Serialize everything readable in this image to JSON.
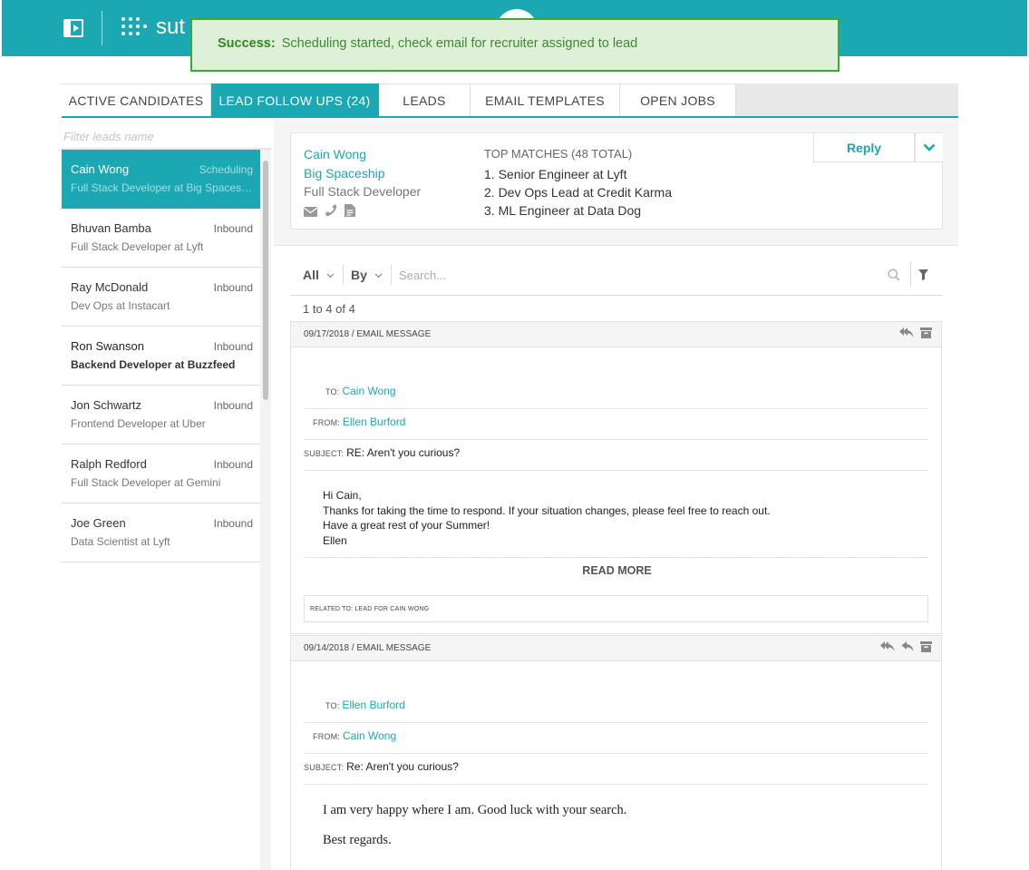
{
  "app": {
    "logo_text": "sut"
  },
  "toast": {
    "label": "Success:",
    "message": " Scheduling started, check email for recruiter assigned to lead"
  },
  "tabs": [
    {
      "label": "ACTIVE CANDIDATES"
    },
    {
      "label": "LEAD FOLLOW UPS (24)"
    },
    {
      "label": "LEADS"
    },
    {
      "label": "EMAIL TEMPLATES"
    },
    {
      "label": "OPEN JOBS"
    }
  ],
  "sidebar": {
    "filter_placeholder": "Filter leads name",
    "leads": [
      {
        "name": "Cain Wong",
        "status": "Scheduling",
        "desc": "Full Stack Developer at Big Spaceship"
      },
      {
        "name": "Bhuvan Bamba",
        "status": "Inbound",
        "desc": "Full Stack Developer at Lyft"
      },
      {
        "name": "Ray McDonald",
        "status": "Inbound",
        "desc": "Dev Ops at Instacart"
      },
      {
        "name": "Ron Swanson",
        "status": "Inbound",
        "desc": "Backend Developer at Buzzfeed"
      },
      {
        "name": "Jon Schwartz",
        "status": "Inbound",
        "desc": "Frontend Developer at Uber"
      },
      {
        "name": "Ralph Redford",
        "status": "Inbound",
        "desc": "Full Stack Developer at Gemini"
      },
      {
        "name": "Joe Green",
        "status": "Inbound",
        "desc": "Data Scientist at Lyft"
      }
    ]
  },
  "lead_card": {
    "name": "Cain Wong",
    "company": "Big Spaceship",
    "title": "Full Stack Developer",
    "matches_header": "TOP MATCHES (48 TOTAL)",
    "matches": [
      "1. Senior Engineer at Lyft",
      "2. Dev Ops Lead at Credit Karma",
      "3. ML Engineer at Data Dog"
    ],
    "reply_label": "Reply"
  },
  "filterbar": {
    "all_label": "All",
    "by_label": "By",
    "search_placeholder": "Search..."
  },
  "count_text": "1 to 4 of 4",
  "labels": {
    "to": "TO:",
    "from": "FROM:",
    "subject": "SUBJECT:"
  },
  "messages": [
    {
      "header": "09/17/2018 / EMAIL MESSAGE",
      "to": "Cain Wong",
      "from": "Ellen Burford",
      "subject": "RE: Aren't you curious?",
      "body": [
        "Hi Cain,",
        "Thanks for taking the time to respond. If your situation changes, please feel free to reach out.",
        "Have a great rest of your Summer!",
        "Ellen"
      ],
      "read_more": "READ MORE",
      "related": "RELATED TO: LEAD FOR CAIN WONG"
    },
    {
      "header": "09/14/2018 / EMAIL MESSAGE",
      "to": "Ellen Burford",
      "from": "Cain Wong",
      "subject": "Re: Aren't you curious?",
      "body": [
        "I am very happy where I am. Good luck with your search.",
        "Best regards."
      ]
    }
  ],
  "colors": {
    "accent": "#1ba8b3",
    "success_bg": "#dff0d8",
    "success_border": "#3aaa35"
  },
  "icons": [
    "panel-toggle-icon",
    "logo-dots-icon",
    "envelope-icon",
    "phone-icon",
    "document-icon",
    "chevron-down-icon",
    "search-icon",
    "filter-icon",
    "reply-all-icon",
    "reply-icon",
    "archive-icon"
  ]
}
